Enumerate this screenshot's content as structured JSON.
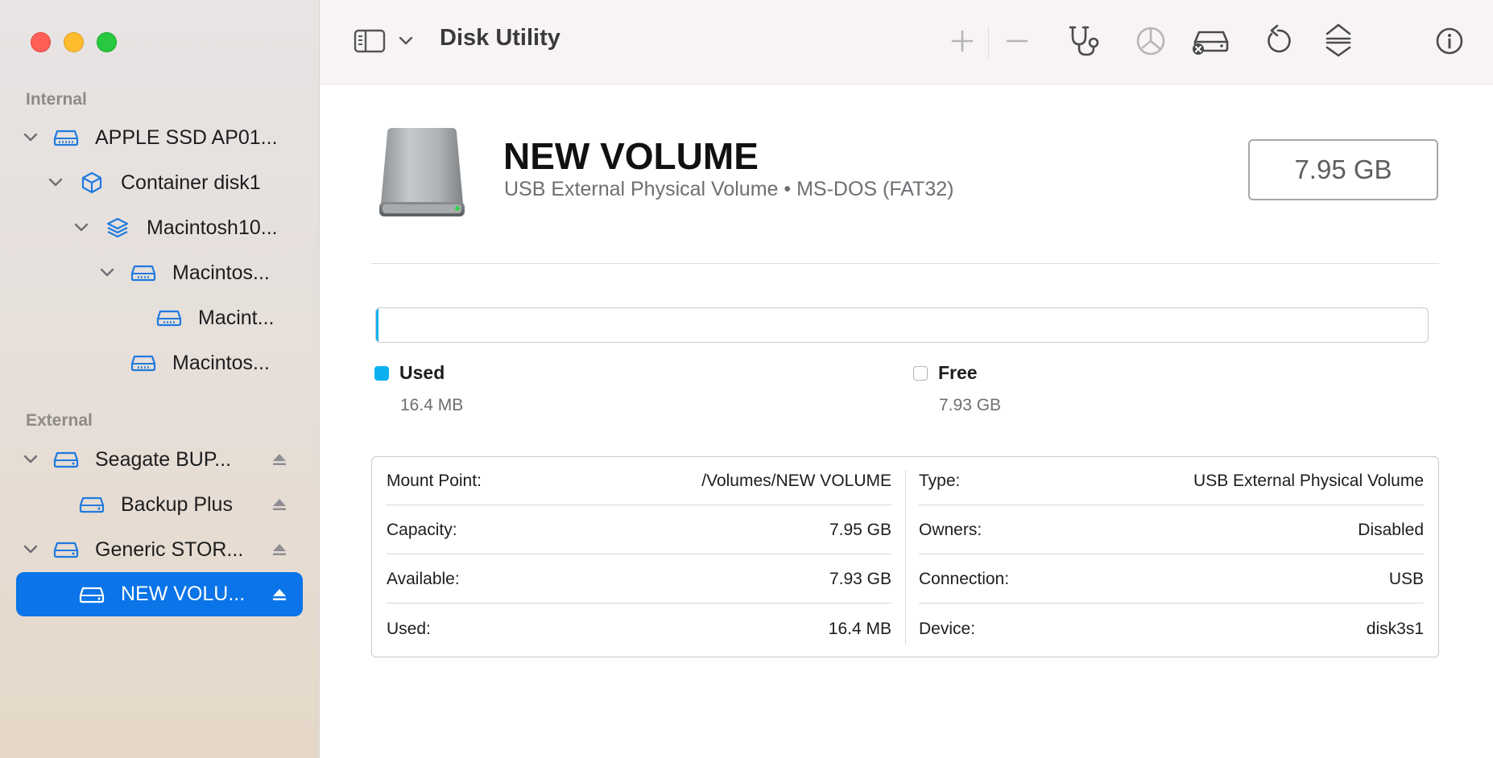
{
  "window": {
    "title": "Disk Utility"
  },
  "sidebar": {
    "sections": {
      "internal": "Internal",
      "external": "External"
    },
    "items": [
      {
        "label": "APPLE SSD AP01...",
        "icon": "internal-drive-icon"
      },
      {
        "label": "Container disk1",
        "icon": "container-cube-icon"
      },
      {
        "label": "Macintosh10...",
        "icon": "volume-stack-icon"
      },
      {
        "label": "Macintos...",
        "icon": "drive-icon"
      },
      {
        "label": "Macint...",
        "icon": "drive-icon"
      },
      {
        "label": "Macintos...",
        "icon": "drive-icon"
      },
      {
        "label": "Seagate BUP...",
        "icon": "external-drive-icon"
      },
      {
        "label": "Backup Plus",
        "icon": "external-drive-icon"
      },
      {
        "label": "Generic STOR...",
        "icon": "external-drive-icon"
      },
      {
        "label": "NEW VOLU...",
        "icon": "external-drive-icon",
        "selected": true
      }
    ]
  },
  "toolbar": {
    "title": "Disk Utility",
    "buttons": [
      "sidebar-toggle-icon",
      "add-icon",
      "remove-icon",
      "first-aid-stethoscope-icon",
      "partition-icon",
      "erase-icon",
      "restore-icon",
      "mount-icon",
      "info-icon"
    ]
  },
  "volume": {
    "name": "NEW VOLUME",
    "subtitle": "USB External Physical Volume • MS-DOS (FAT32)",
    "size": "7.95 GB",
    "used_fraction": 0.002
  },
  "legend": {
    "used_label": "Used",
    "used_value": "16.4 MB",
    "free_label": "Free",
    "free_value": "7.93 GB"
  },
  "colors": {
    "used": "#0bb0f0",
    "accent": "#0a74e8"
  },
  "info": {
    "left": [
      {
        "key": "Mount Point:",
        "value": "/Volumes/NEW VOLUME"
      },
      {
        "key": "Capacity:",
        "value": "7.95 GB"
      },
      {
        "key": "Available:",
        "value": "7.93 GB"
      },
      {
        "key": "Used:",
        "value": "16.4 MB"
      }
    ],
    "right": [
      {
        "key": "Type:",
        "value": "USB External Physical Volume"
      },
      {
        "key": "Owners:",
        "value": "Disabled"
      },
      {
        "key": "Connection:",
        "value": "USB"
      },
      {
        "key": "Device:",
        "value": "disk3s1"
      }
    ]
  }
}
